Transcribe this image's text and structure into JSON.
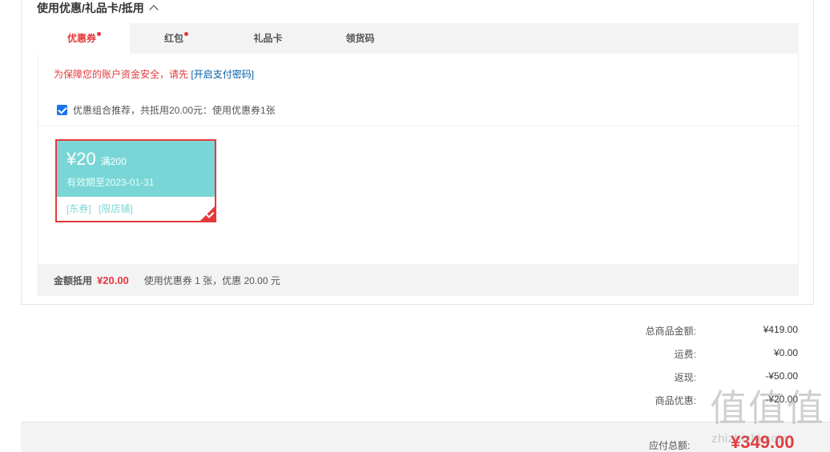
{
  "section": {
    "title": "使用优惠/礼品卡/抵用"
  },
  "tabs": [
    {
      "label": "优惠券",
      "dot": true
    },
    {
      "label": "红包",
      "dot": true
    },
    {
      "label": "礼品卡",
      "dot": false
    },
    {
      "label": "领货码",
      "dot": false
    }
  ],
  "notice": {
    "text": "为保障您的账户资金安全，请先",
    "link": "[开启支付密码]"
  },
  "combo": {
    "checked": true,
    "text": "优惠组合推荐，共抵用20.00元：使用优惠券1张"
  },
  "coupon": {
    "amount": "¥20",
    "threshold": "满200",
    "validity": "有效期至2023-01-31",
    "tag1": "[东券]",
    "tag2": "[限店铺]",
    "selected": true
  },
  "summary": {
    "label": "金额抵用",
    "value": "¥20.00",
    "desc": "使用优惠券 1 张，优惠 20.00 元"
  },
  "totals": [
    {
      "label": "总商品金额:",
      "value": "¥419.00"
    },
    {
      "label": "运费:",
      "value": "¥0.00"
    },
    {
      "label": "返现:",
      "value": "-¥50.00"
    },
    {
      "label": "商品优惠:",
      "value": "-¥20.00"
    }
  ],
  "due": {
    "label": "应付总额:",
    "value": "¥349.00"
  },
  "watermark": {
    "glyphs": "值值值",
    "text": "zhizhizhi.com"
  },
  "colors": {
    "accent": "#e4393c",
    "coupon": "#7ad6d6",
    "link": "#005ea7"
  }
}
